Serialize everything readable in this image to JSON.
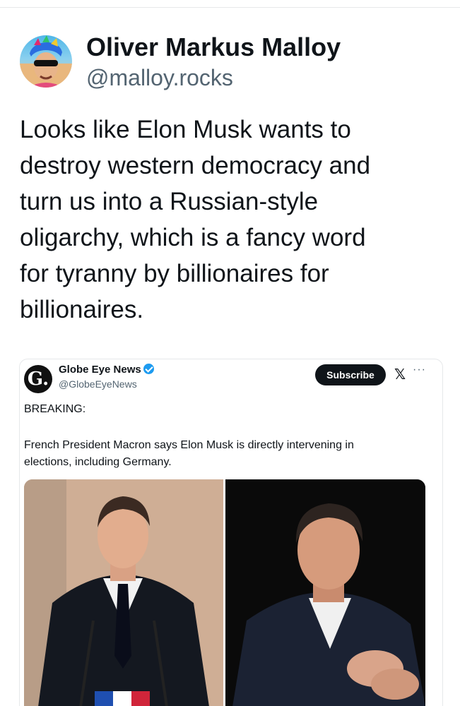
{
  "post": {
    "author_name": "Oliver Markus Malloy",
    "author_handle": "@malloy.rocks",
    "text_lines": [
      "Looks like Elon Musk wants to",
      "destroy western democracy and",
      "turn us into a Russian-style",
      "oligarchy, which is a fancy word",
      "for tyranny by billionaires for",
      "billionaires."
    ]
  },
  "embed": {
    "logo_letter": "G.",
    "account_name": "Globe Eye News",
    "account_handle": "@GlobeEyeNews",
    "subscribe_label": "Subscribe",
    "x_logo": "𝕏",
    "more_glyph": "···",
    "breaking_label": "BREAKING:",
    "headline_lines": [
      "French President Macron says Elon Musk is directly intervening in",
      "elections, including Germany."
    ],
    "icons": [
      "verified-badge-icon",
      "x-logo-icon",
      "more-options-icon"
    ]
  },
  "colors": {
    "text_primary": "#0f1419",
    "text_secondary": "#536471",
    "verified_blue": "#1d9bf0",
    "subscribe_bg": "#0f1419"
  }
}
